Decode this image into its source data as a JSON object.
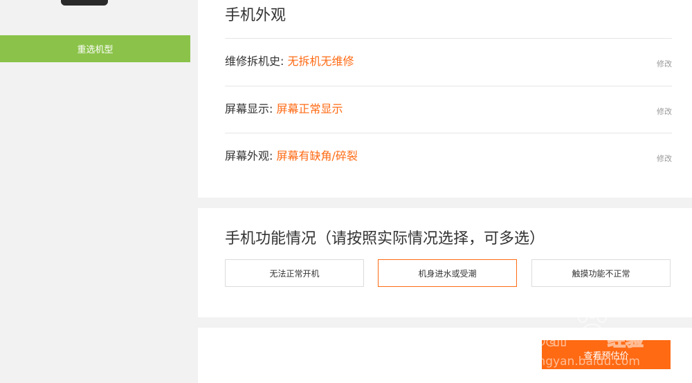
{
  "sidebar": {
    "reselect_label": "重选机型"
  },
  "appearance": {
    "title": "手机外观",
    "rows": [
      {
        "label": "维修拆机史: ",
        "value": "无拆机无维修",
        "edit": "修改"
      },
      {
        "label": "屏幕显示: ",
        "value": "屏幕正常显示",
        "edit": "修改"
      },
      {
        "label": "屏幕外观: ",
        "value": "屏幕有缺角/碎裂",
        "edit": "修改"
      }
    ]
  },
  "function": {
    "title": "手机功能情况（请按照实际情况选择，可多选）",
    "options": [
      {
        "label": "无法正常开机",
        "selected": false
      },
      {
        "label": "机身进水或受潮",
        "selected": true
      },
      {
        "label": "触摸功能不正常",
        "selected": false
      }
    ]
  },
  "footer": {
    "estimate_label": "查看预估价"
  },
  "watermark": {
    "brand": "Baidu经验",
    "url": "jingyan.baidu.com"
  },
  "colors": {
    "accent": "#ff6a13",
    "sidebar_button": "#8bc34a",
    "background": "#f2f2f2"
  }
}
